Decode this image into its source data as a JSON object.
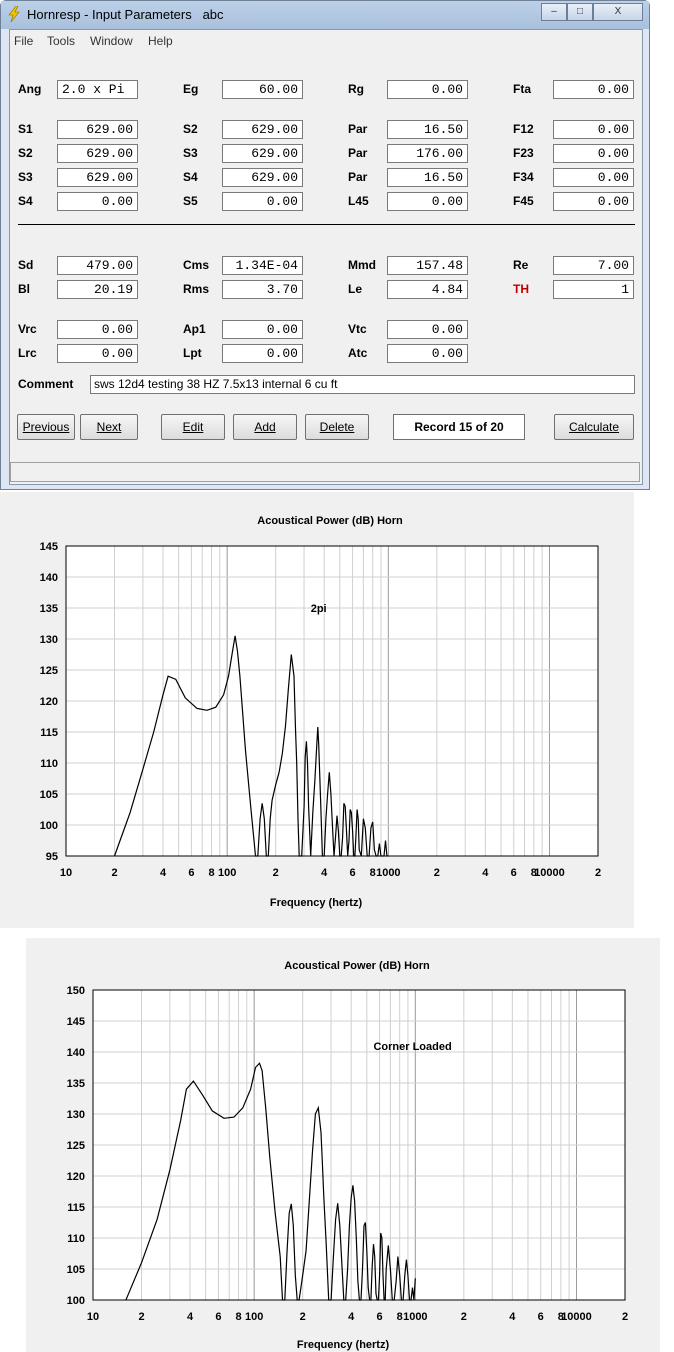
{
  "window": {
    "title": "Hornresp - Input Parameters",
    "subtitle": "abc",
    "menu": [
      "File",
      "Tools",
      "Window",
      "Help"
    ],
    "controls": {
      "minimize": "–",
      "maximize": "□",
      "close": "X"
    }
  },
  "params": {
    "r1": [
      {
        "label": "Ang",
        "value": "2.0 x Pi"
      },
      {
        "label": "Eg",
        "value": "60.00"
      },
      {
        "label": "Rg",
        "value": "0.00"
      },
      {
        "label": "Fta",
        "value": "0.00"
      }
    ],
    "r2": [
      {
        "label": "S1",
        "value": "629.00"
      },
      {
        "label": "S2",
        "value": "629.00"
      },
      {
        "label": "Par",
        "value": "16.50"
      },
      {
        "label": "F12",
        "value": "0.00"
      }
    ],
    "r3": [
      {
        "label": "S2",
        "value": "629.00"
      },
      {
        "label": "S3",
        "value": "629.00"
      },
      {
        "label": "Par",
        "value": "176.00"
      },
      {
        "label": "F23",
        "value": "0.00"
      }
    ],
    "r4": [
      {
        "label": "S3",
        "value": "629.00"
      },
      {
        "label": "S4",
        "value": "629.00"
      },
      {
        "label": "Par",
        "value": "16.50"
      },
      {
        "label": "F34",
        "value": "0.00"
      }
    ],
    "r5": [
      {
        "label": "S4",
        "value": "0.00"
      },
      {
        "label": "S5",
        "value": "0.00"
      },
      {
        "label": "L45",
        "value": "0.00"
      },
      {
        "label": "F45",
        "value": "0.00"
      }
    ],
    "r6": [
      {
        "label": "Sd",
        "value": "479.00"
      },
      {
        "label": "Cms",
        "value": "1.34E-04"
      },
      {
        "label": "Mmd",
        "value": "157.48"
      },
      {
        "label": "Re",
        "value": "7.00"
      }
    ],
    "r7": [
      {
        "label": "Bl",
        "value": "20.19"
      },
      {
        "label": "Rms",
        "value": "3.70"
      },
      {
        "label": "Le",
        "value": "4.84"
      },
      {
        "label": "TH",
        "value": "1"
      }
    ],
    "r8": [
      {
        "label": "Vrc",
        "value": "0.00"
      },
      {
        "label": "Ap1",
        "value": "0.00"
      },
      {
        "label": "Vtc",
        "value": "0.00"
      }
    ],
    "r9": [
      {
        "label": "Lrc",
        "value": "0.00"
      },
      {
        "label": "Lpt",
        "value": "0.00"
      },
      {
        "label": "Atc",
        "value": "0.00"
      }
    ]
  },
  "comment": {
    "label": "Comment",
    "value": "sws 12d4 testing 38 HZ 7.5x13 internal 6 cu ft"
  },
  "buttons": {
    "previous": "Previous",
    "next": "Next",
    "edit": "Edit",
    "add": "Add",
    "delete": "Delete",
    "record": "Record 15 of 20",
    "calculate": "Calculate"
  },
  "chart_data": [
    {
      "type": "line",
      "title": "Acoustical Power (dB)    Horn",
      "xlabel": "Frequency (hertz)",
      "ylabel": "",
      "xscale": "log",
      "xlim": [
        10,
        20000
      ],
      "ylim": [
        95,
        145
      ],
      "yticks": [
        95,
        100,
        105,
        110,
        115,
        120,
        125,
        130,
        135,
        140,
        145
      ],
      "xticks": [
        {
          "v": 10,
          "t": "10"
        },
        {
          "v": 20,
          "t": "2"
        },
        {
          "v": 40,
          "t": "4"
        },
        {
          "v": 60,
          "t": "6"
        },
        {
          "v": 80,
          "t": "8"
        },
        {
          "v": 100,
          "t": "100"
        },
        {
          "v": 200,
          "t": "2"
        },
        {
          "v": 400,
          "t": "4"
        },
        {
          "v": 600,
          "t": "6"
        },
        {
          "v": 800,
          "t": "8"
        },
        {
          "v": 1000,
          "t": "1000"
        },
        {
          "v": 2000,
          "t": "2"
        },
        {
          "v": 4000,
          "t": "4"
        },
        {
          "v": 6000,
          "t": "6"
        },
        {
          "v": 8000,
          "t": "8"
        },
        {
          "v": 10000,
          "t": "10000"
        },
        {
          "v": 20000,
          "t": "2"
        }
      ],
      "annotation": {
        "text": "2pi",
        "x": 330,
        "y": 135
      },
      "grid": true,
      "series": [
        {
          "x": [
            20,
            25,
            30,
            35,
            40,
            43,
            48,
            55,
            65,
            75,
            85,
            95,
            102,
            108,
            112,
            116,
            120,
            130,
            140,
            150,
            155,
            160,
            165,
            170,
            175,
            180,
            185,
            190,
            200,
            210,
            220,
            230,
            240,
            250,
            260,
            265,
            270,
            275,
            280,
            290,
            300,
            305,
            310,
            315,
            320,
            330,
            340,
            350,
            360,
            365,
            370,
            380,
            390,
            400,
            410,
            420,
            430,
            440,
            450,
            460,
            470,
            480,
            490,
            500,
            510,
            520,
            530,
            540,
            550,
            560,
            570,
            580,
            590,
            600,
            610,
            620,
            630,
            640,
            650,
            660,
            680,
            700,
            720,
            740,
            760,
            780,
            800,
            820,
            840,
            860,
            880,
            900,
            920,
            940,
            960,
            980,
            1000
          ],
          "y": [
            95,
            102,
            109,
            115,
            121,
            124,
            123.5,
            120.5,
            118.8,
            118.5,
            119,
            121,
            124,
            128,
            130.5,
            128,
            124,
            112,
            103,
            95,
            95,
            101,
            103.5,
            101,
            95,
            95,
            101,
            104,
            106.5,
            108.5,
            111.5,
            116,
            122,
            127.5,
            124,
            116,
            110,
            101,
            95,
            95,
            103,
            111,
            113.5,
            110,
            103,
            95,
            102,
            107,
            113,
            115.8,
            113,
            104,
            95,
            95,
            101,
            105,
            108.5,
            105,
            100,
            95,
            98,
            101.5,
            99,
            95,
            95,
            98,
            103.5,
            103,
            99,
            95,
            97.5,
            102.5,
            102,
            99,
            95,
            95,
            98.5,
            102.5,
            101,
            96,
            95,
            101,
            99.5,
            95,
            95,
            99.5,
            100.5,
            96,
            95,
            95,
            97,
            95,
            95,
            95,
            97.5,
            95,
            95
          ]
        }
      ]
    },
    {
      "type": "line",
      "title": "Acoustical Power (dB)    Horn",
      "xlabel": "Frequency (hertz)",
      "ylabel": "",
      "xscale": "log",
      "xlim": [
        10,
        20000
      ],
      "ylim": [
        100,
        150
      ],
      "yticks": [
        100,
        105,
        110,
        115,
        120,
        125,
        130,
        135,
        140,
        145,
        150
      ],
      "xticks": [
        {
          "v": 10,
          "t": "10"
        },
        {
          "v": 20,
          "t": "2"
        },
        {
          "v": 40,
          "t": "4"
        },
        {
          "v": 60,
          "t": "6"
        },
        {
          "v": 80,
          "t": "8"
        },
        {
          "v": 100,
          "t": "100"
        },
        {
          "v": 200,
          "t": "2"
        },
        {
          "v": 400,
          "t": "4"
        },
        {
          "v": 600,
          "t": "6"
        },
        {
          "v": 800,
          "t": "8"
        },
        {
          "v": 1000,
          "t": "1000"
        },
        {
          "v": 2000,
          "t": "2"
        },
        {
          "v": 4000,
          "t": "4"
        },
        {
          "v": 6000,
          "t": "6"
        },
        {
          "v": 8000,
          "t": "8"
        },
        {
          "v": 10000,
          "t": "10000"
        },
        {
          "v": 20000,
          "t": "2"
        }
      ],
      "annotation": {
        "text": "Corner Loaded",
        "x": 550,
        "y": 141
      },
      "grid": true,
      "series": [
        {
          "x": [
            16,
            20,
            25,
            30,
            35,
            38,
            42,
            48,
            55,
            65,
            75,
            85,
            95,
            102,
            108,
            112,
            118,
            125,
            135,
            145,
            150,
            155,
            160,
            165,
            170,
            175,
            180,
            185,
            190,
            200,
            210,
            220,
            230,
            240,
            250,
            260,
            265,
            270,
            280,
            290,
            300,
            310,
            320,
            330,
            340,
            350,
            360,
            370,
            380,
            390,
            400,
            410,
            420,
            430,
            440,
            450,
            460,
            470,
            480,
            490,
            500,
            510,
            520,
            530,
            540,
            550,
            560,
            570,
            580,
            590,
            600,
            610,
            620,
            630,
            640,
            650,
            660,
            680,
            700,
            720,
            740,
            760,
            780,
            800,
            820,
            840,
            860,
            880,
            900,
            920,
            940,
            960,
            980,
            1000
          ],
          "y": [
            100,
            106,
            113,
            121,
            129,
            134,
            135.3,
            133,
            130.5,
            129.3,
            129.5,
            131,
            134,
            137.5,
            138.2,
            137,
            131,
            123,
            114,
            107,
            100,
            100,
            108,
            114,
            115.5,
            112,
            104,
            100,
            100,
            104,
            108,
            116,
            124,
            130,
            131,
            127,
            122,
            117,
            109,
            100,
            100,
            107,
            113,
            115.6,
            112,
            106,
            100,
            100,
            105,
            112,
            116.5,
            118.5,
            116,
            110,
            103,
            100,
            100,
            105,
            112,
            112.5,
            108,
            102,
            100,
            100,
            105.5,
            109,
            107,
            101,
            100,
            100,
            104,
            110.8,
            110,
            104,
            100,
            100,
            105,
            108.8,
            105,
            100,
            100,
            103,
            107,
            104,
            100,
            100,
            104,
            106.5,
            104,
            100,
            100,
            102,
            100,
            103.5
          ]
        }
      ]
    }
  ]
}
